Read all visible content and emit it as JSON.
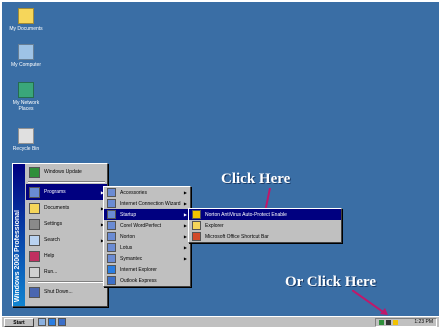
{
  "desktop": {
    "background": "#3a6ea5",
    "icons": [
      {
        "label": "My Documents",
        "icon": "folder-icon",
        "color": "#f6d65a"
      },
      {
        "label": "My Computer",
        "icon": "computer-icon",
        "color": "#9ec3e6"
      },
      {
        "label": "My Network Places",
        "icon": "network-icon",
        "color": "#3aa67a"
      },
      {
        "label": "Recycle Bin",
        "icon": "recycle-bin-icon",
        "color": "#e0e0e0"
      }
    ]
  },
  "callouts": {
    "click_here": "Click Here",
    "or_click_here": "Or Click Here",
    "arrow_color": "#c0186a"
  },
  "start_menu": {
    "banner": "Windows 2000 Professional",
    "items": [
      {
        "label": "Windows Update",
        "icon": "windows-update-icon",
        "has_submenu": false
      },
      {
        "label": "Programs",
        "icon": "programs-icon",
        "has_submenu": true,
        "highlighted": true
      },
      {
        "label": "Documents",
        "icon": "documents-icon",
        "has_submenu": true
      },
      {
        "label": "Settings",
        "icon": "settings-icon",
        "has_submenu": true
      },
      {
        "label": "Search",
        "icon": "search-icon",
        "has_submenu": true
      },
      {
        "label": "Help",
        "icon": "help-icon",
        "has_submenu": false
      },
      {
        "label": "Run...",
        "icon": "run-icon",
        "has_submenu": false
      },
      {
        "label": "Shut Down...",
        "icon": "shutdown-icon",
        "has_submenu": false
      }
    ]
  },
  "programs_menu": {
    "items": [
      {
        "label": "Accessories",
        "icon": "accessories-icon",
        "has_submenu": true
      },
      {
        "label": "Internet Connection Wizard",
        "icon": "wizard-icon",
        "has_submenu": true
      },
      {
        "label": "Startup",
        "icon": "startup-icon",
        "has_submenu": true,
        "highlighted": true
      },
      {
        "label": "Corel WordPerfect",
        "icon": "program-group-icon",
        "has_submenu": true
      },
      {
        "label": "Norton",
        "icon": "program-group-icon",
        "has_submenu": true
      },
      {
        "label": "Lotus",
        "icon": "program-group-icon",
        "has_submenu": true
      },
      {
        "label": "Symantec",
        "icon": "program-group-icon",
        "has_submenu": true
      },
      {
        "label": "Internet Explorer",
        "icon": "internet-explorer-icon",
        "has_submenu": false
      },
      {
        "label": "Outlook Express",
        "icon": "outlook-express-icon",
        "has_submenu": false
      }
    ]
  },
  "accessories_menu": {
    "items": [
      {
        "label": "Norton AntiVirus Auto-Protect Enable",
        "icon": "antivirus-icon",
        "highlighted": true
      },
      {
        "label": "Explorer",
        "icon": "explorer-icon"
      },
      {
        "label": "Microsoft Office Shortcut Bar",
        "icon": "office-icon"
      }
    ]
  },
  "taskbar": {
    "start_label": "Start",
    "clock": "1:23 PM",
    "tray_icons": [
      "network-tray-icon",
      "volume-tray-icon",
      "antivirus-tray-icon"
    ]
  }
}
